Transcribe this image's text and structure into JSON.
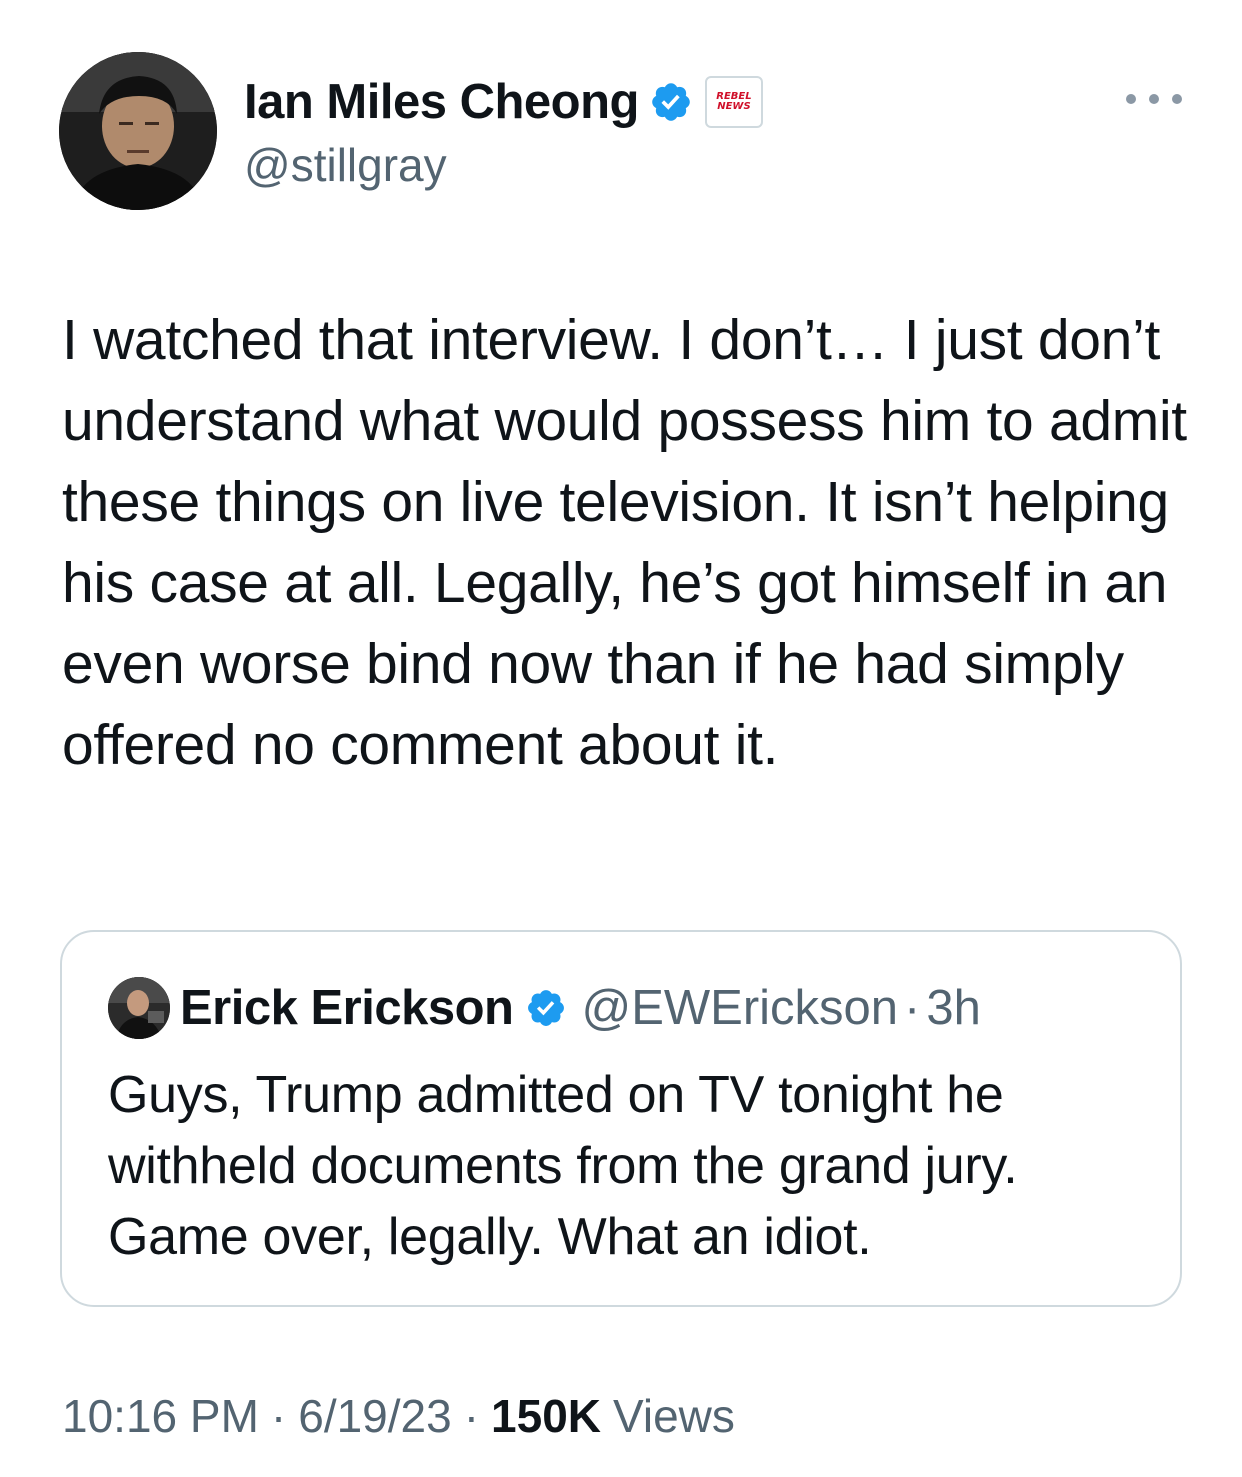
{
  "author": {
    "display_name": "Ian Miles Cheong",
    "handle": "@stillgray",
    "verified": true,
    "affiliate_badge": [
      "REBEL",
      "NEWS"
    ]
  },
  "tweet": {
    "text": "I watched that interview. I don’t… I just don’t understand what would possess him to admit these things on live television. It isn’t helping his case at all. Legally, he’s got himself in an even worse bind now than if he had simply offered no comment about it."
  },
  "quoted_tweet": {
    "display_name": "Erick Erickson",
    "handle": "@EWErickson",
    "separator": "·",
    "time": "3h",
    "verified": true,
    "text": "Guys, Trump admitted on TV tonight he withheld documents from the grand jury. Game over, legally. What an idiot."
  },
  "meta": {
    "time": "10:16 PM",
    "date": "6/19/23",
    "separator": "·",
    "views_count": "150K",
    "views_label": "Views"
  },
  "colors": {
    "text_primary": "#0f1419",
    "text_secondary": "#536471",
    "verified_blue": "#1d9bf0",
    "border": "#cfd9de",
    "affiliate_red": "#d0102a"
  },
  "icons": {
    "verified": "verified-badge-icon",
    "more": "more-dots-icon"
  }
}
